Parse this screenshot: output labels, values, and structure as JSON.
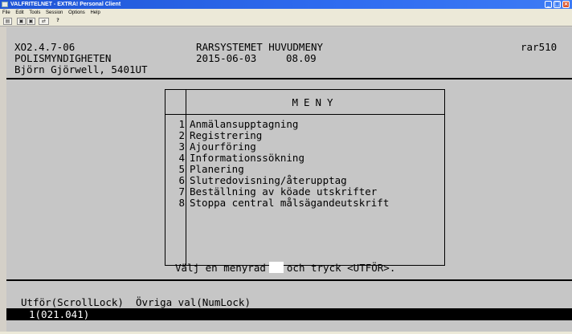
{
  "window": {
    "title": "VALFRITELNET - EXTRA! Personal Client",
    "minimize": "_",
    "maximize": "□",
    "close": "×"
  },
  "menubar": [
    "File",
    "Edit",
    "Tools",
    "Session",
    "Options",
    "Help"
  ],
  "toolbar": [
    "▤",
    "▣",
    "▣",
    "⇄",
    "?"
  ],
  "header": {
    "line1_left": "XO2.4.7-06",
    "line1_mid": "RARSYSTEMET HUVUDMENY",
    "line1_right": "rar510",
    "line2_left": "POLISMYNDIGHETEN",
    "line2_date": "2015-06-03",
    "line2_time": "08.09",
    "line3_left": "Björn Gjörwell, 5401UT"
  },
  "menu": {
    "title": "MENY",
    "items": [
      {
        "num": "1",
        "label": "Anmälansupptagning"
      },
      {
        "num": "2",
        "label": "Registrering"
      },
      {
        "num": "3",
        "label": "Ajourföring"
      },
      {
        "num": "4",
        "label": "Informationssökning"
      },
      {
        "num": "5",
        "label": "Planering"
      },
      {
        "num": "6",
        "label": "Slutredovisning/återupptag"
      },
      {
        "num": "7",
        "label": "Beställning av köade utskrifter"
      },
      {
        "num": "8",
        "label": "Stoppa central målsägandeutskrift"
      }
    ]
  },
  "prompt": {
    "before": "Välj en menyrad",
    "after": "och tryck <UTFÖR>.",
    "field_value": ""
  },
  "fkeys": "Utför(ScrollLock)  Övriga val(NumLock)",
  "status": "1(021.041)"
}
